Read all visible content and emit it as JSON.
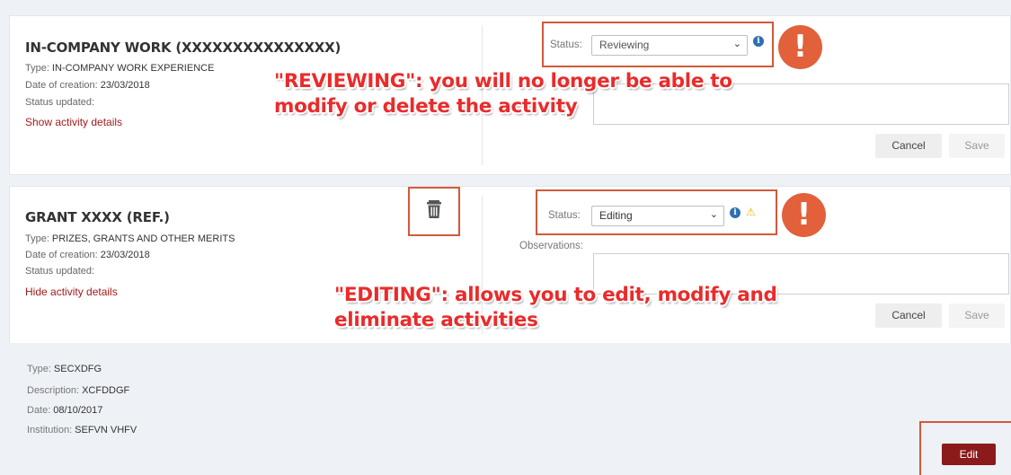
{
  "activity1": {
    "title": "IN-COMPANY WORK (XXXXXXXXXXXXXXX)",
    "type_label": "Type:",
    "type_value": "IN-COMPANY WORK EXPERIENCE",
    "date_label": "Date of creation:",
    "date_value": "23/03/2018",
    "status_updated_label": "Status updated:",
    "details_link": "Show activity details",
    "status_label": "Status:",
    "status_value": "Reviewing",
    "cancel_label": "Cancel",
    "save_label": "Save"
  },
  "activity2": {
    "title": "GRANT XXXX (REF.)",
    "type_label": "Type:",
    "type_value": "PRIZES, GRANTS AND OTHER MERITS",
    "date_label": "Date of creation:",
    "date_value": "23/03/2018",
    "status_updated_label": "Status updated:",
    "details_link": "Hide activity details",
    "status_label": "Status:",
    "status_value": "Editing",
    "observations_label": "Observations:",
    "cancel_label": "Cancel",
    "save_label": "Save",
    "details": {
      "type_label": "Type:",
      "type_value": "SECXDFG",
      "description_label": "Description:",
      "description_value": "XCFDDGF",
      "date_label": "Date:",
      "date_value": "08/10/2017",
      "institution_label": "Institution:",
      "institution_value": "SEFVN VHFV",
      "edit_label": "Edit"
    }
  },
  "annotations": {
    "reviewing_line1": "\"REVIEWING\": you will no longer be able to",
    "reviewing_line2": "modify or delete the activity",
    "editing_line1": "\"EDITING\": allows you to edit, modify and",
    "editing_line2": "eliminate activities",
    "alert_glyph": "!"
  },
  "colors": {
    "link_red": "#a4191c",
    "edit_button": "#8b1a1a",
    "annotation_red": "#ea2b2b",
    "highlight_box": "#d15a3a",
    "info_blue": "#2f6fb4",
    "warning_yellow": "#e9b500"
  },
  "icons": {
    "info": "info-circle-icon",
    "warning": "warning-triangle-icon",
    "trash": "trash-icon",
    "chevron": "chevron-down-icon",
    "alert": "exclamation-alert-icon"
  }
}
